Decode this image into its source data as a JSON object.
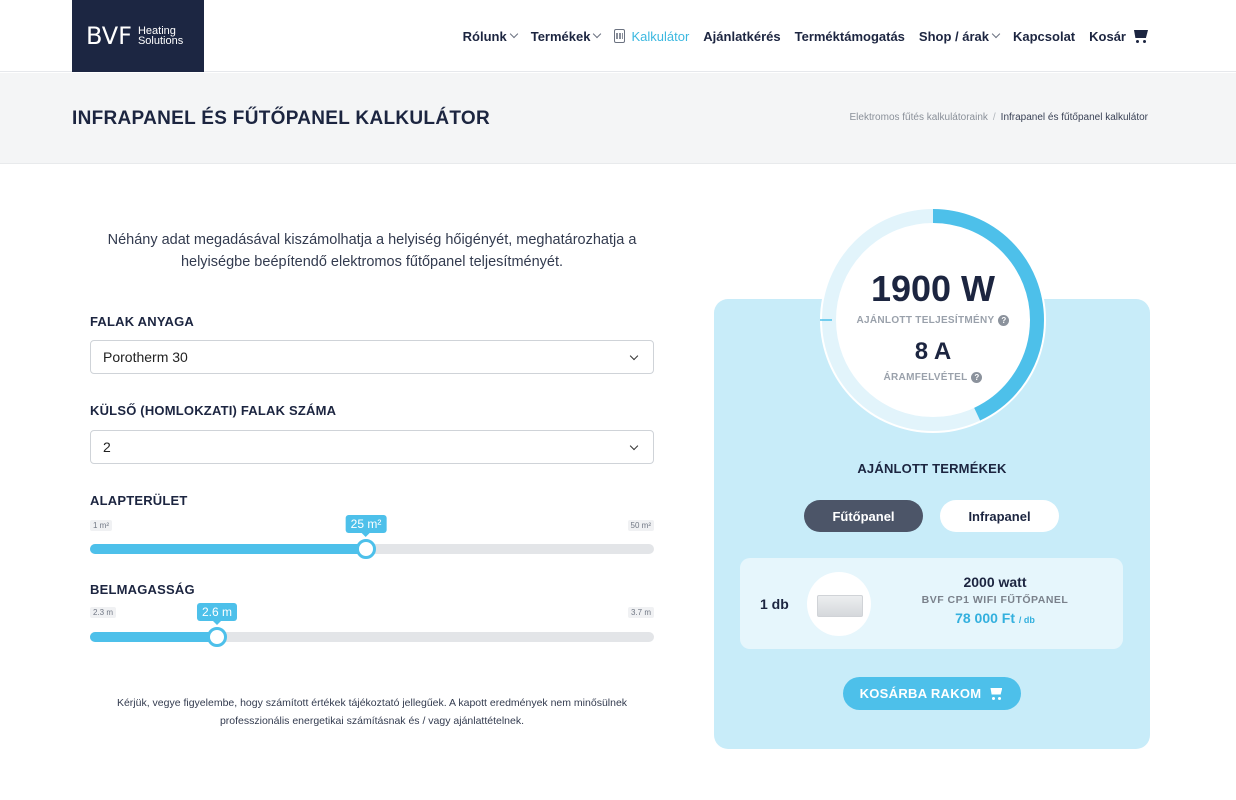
{
  "header": {
    "logo_main": "BVF",
    "logo_sub1": "Heating",
    "logo_sub2": "Solutions",
    "nav": [
      {
        "label": "Rólunk",
        "has_dropdown": true
      },
      {
        "label": "Termékek",
        "has_dropdown": true
      },
      {
        "label": "Kalkulátor",
        "active": true,
        "icon": "calculator-icon"
      },
      {
        "label": "Ajánlatkérés"
      },
      {
        "label": "Terméktámogatás"
      },
      {
        "label": "Shop / árak",
        "has_dropdown": true
      },
      {
        "label": "Kapcsolat"
      },
      {
        "label": "Kosár",
        "icon": "cart-icon"
      }
    ]
  },
  "title_band": {
    "title": "INFRAPANEL ÉS FŰTŐPANEL KALKULÁTOR",
    "breadcrumb_parent": "Elektromos fűtés kalkulátoraink",
    "breadcrumb_sep": "/",
    "breadcrumb_current": "Infrapanel és fűtőpanel kalkulátor"
  },
  "form": {
    "intro": "Néhány adat megadásával kiszámolhatja a helyiség hőigényét, meghatározhatja a helyiségbe beépítendő elektromos fűtőpanel teljesítményét.",
    "walls_label": "FALAK ANYAGA",
    "walls_value": "Porotherm 30",
    "ext_walls_label": "KÜLSŐ (HOMLOKZATI) FALAK SZÁMA",
    "ext_walls_value": "2",
    "area": {
      "label": "ALAPTERÜLET",
      "min": "1 m²",
      "max": "50 m²",
      "value": "25 m²",
      "fraction": 0.49
    },
    "height": {
      "label": "BELMAGASSÁG",
      "min": "2.3 m",
      "max": "3.7 m",
      "value": "2.6 m",
      "fraction": 0.225
    },
    "disclaimer": "Kérjük, vegye figyelembe, hogy számított értékek tájékoztató jellegűek. A kapott eredmények nem minősülnek professzionális energetikai számításnak és / vagy ajánlattételnek."
  },
  "result": {
    "power": "1900 W",
    "power_label": "AJÁNLOTT TELJESÍTMÉNY",
    "current": "8 A",
    "current_label": "ÁRAMFELVÉTEL",
    "gauge_fraction": 0.43,
    "accent": "#4dc0ea",
    "recommended_title": "AJÁNLOTT TERMÉKEK",
    "tab_active": "Fűtőpanel",
    "tab_inactive": "Infrapanel",
    "product": {
      "qty": "1 db",
      "watt": "2000 watt",
      "name": "BVF CP1 WIFI FŰTŐPANEL",
      "price": "78 000 Ft",
      "price_unit": "/ db"
    },
    "cart_button": "KOSÁRBA RAKOM"
  }
}
